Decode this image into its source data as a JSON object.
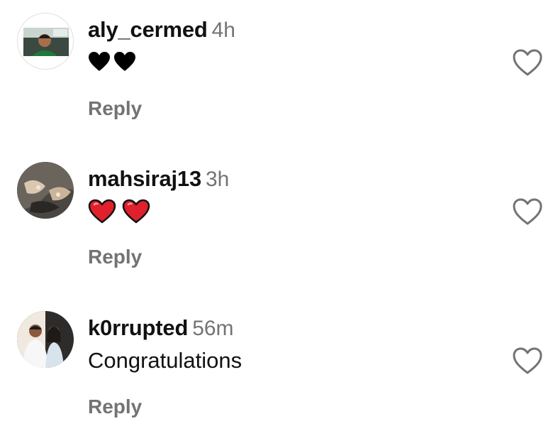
{
  "comments": [
    {
      "username": "aly_cermed",
      "time": "4h",
      "text": "",
      "emojis": [
        "black-heart",
        "black-heart"
      ],
      "reply_label": "Reply"
    },
    {
      "username": "mahsiraj13",
      "time": "3h",
      "text": "",
      "emojis": [
        "red-heart",
        "red-heart"
      ],
      "reply_label": "Reply"
    },
    {
      "username": "k0rrupted",
      "time": "56m",
      "text": "Congratulations",
      "emojis": [],
      "reply_label": "Reply"
    }
  ],
  "icons": {
    "like": "heart-outline-icon",
    "black_heart": "black-heart-emoji-icon",
    "red_heart": "red-heart-emoji-icon"
  },
  "colors": {
    "username": "#111111",
    "meta": "#737373",
    "like_outline": "#737373",
    "red_heart": "#e0202c",
    "black_heart": "#000000"
  }
}
